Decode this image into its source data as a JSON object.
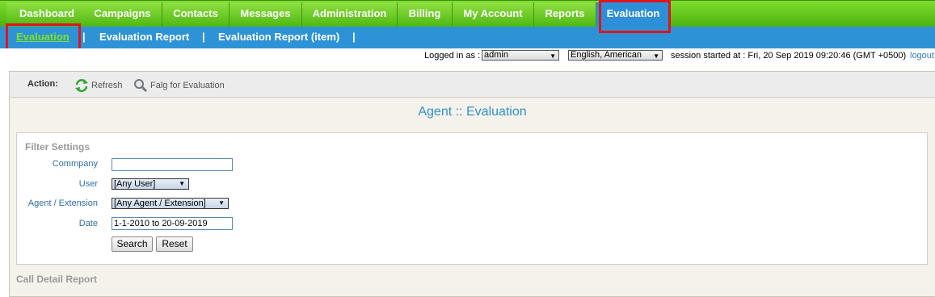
{
  "topnav": {
    "tabs": [
      "Dashboard",
      "Campaigns",
      "Contacts",
      "Messages",
      "Administration",
      "Billing",
      "My Account",
      "Reports",
      "Evaluation"
    ],
    "active": "Evaluation"
  },
  "subnav": {
    "items": [
      "Evaluation",
      "Evaluation Report",
      "Evaluation Report (item)"
    ],
    "separator": "|"
  },
  "status": {
    "logged_in_label": "Logged in as :",
    "user": "admin",
    "language": "English, American",
    "session_text": "session started at : Fri, 20 Sep 2019 09:20:46 (GMT +0500)",
    "logout": "logout"
  },
  "actionbar": {
    "label": "Action:",
    "refresh": "Refresh",
    "flag": "Falg for Evaluation"
  },
  "page": {
    "title": "Agent :: Evaluation"
  },
  "filter": {
    "legend": "Filter Settings",
    "company_label": "Commpany",
    "company_value": "",
    "user_label": "User",
    "user_value": "[Any User]",
    "agent_label": "Agent / Extension",
    "agent_value": "[Any Agent / Extension]",
    "date_label": "Date",
    "date_value": "1-1-2010 to 20-09-2019",
    "search": "Search",
    "reset": "Reset"
  },
  "report": {
    "title": "Call Detail Report"
  },
  "colors": {
    "green": "#5cc41a",
    "blue": "#2e93d6",
    "highlight": "#e0141e"
  }
}
